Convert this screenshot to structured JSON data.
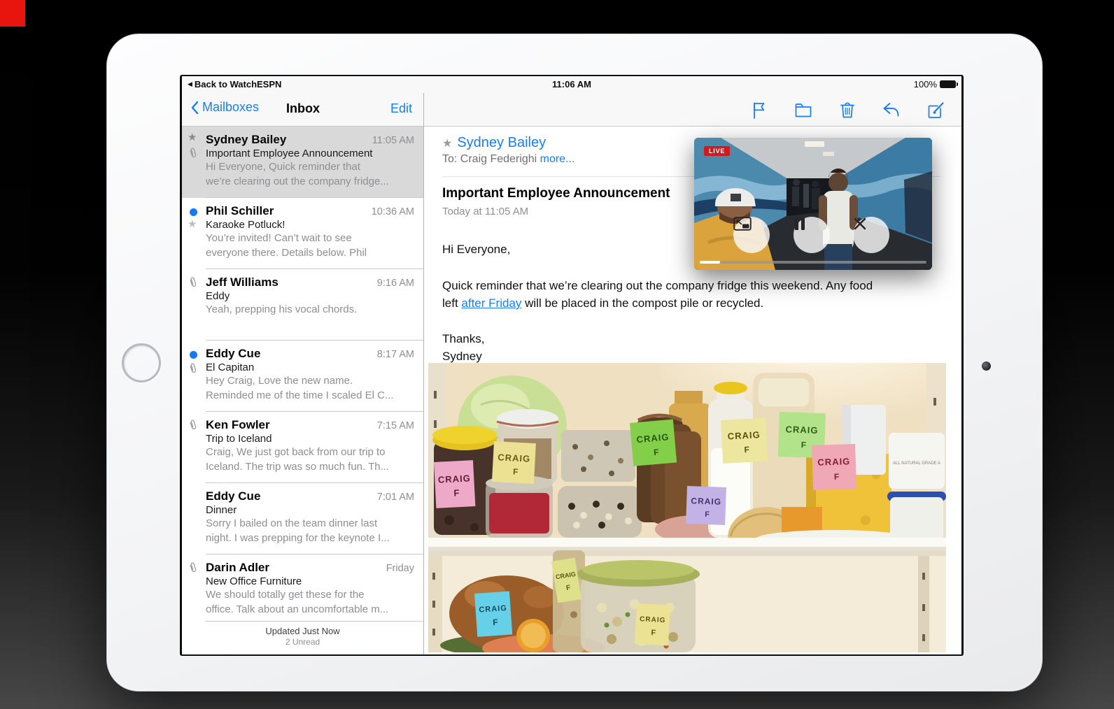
{
  "status_bar": {
    "back": "Back to WatchESPN",
    "time": "11:06 AM",
    "battery": "100%"
  },
  "nav": {
    "back": "Mailboxes",
    "title": "Inbox",
    "edit": "Edit"
  },
  "toolbar": {
    "icons": [
      "flag-icon",
      "folder-icon",
      "trash-icon",
      "reply-icon",
      "compose-icon"
    ],
    "color": "#157ef6"
  },
  "inbox": {
    "rows": [
      {
        "sender": "Sydney Bailey",
        "time": "11:05 AM",
        "subject": "Important Employee Announcement",
        "preview1": "Hi Everyone, Quick reminder that",
        "preview2": "we’re clearing out the company fridge..."
      },
      {
        "sender": "Phil Schiller",
        "time": "10:36 AM",
        "subject": "Karaoke Potluck!",
        "preview1": "You’re invited! Can’t wait to see",
        "preview2": "everyone there. Details below. Phil"
      },
      {
        "sender": "Jeff Williams",
        "time": "9:16 AM",
        "subject": "Eddy",
        "preview1": "Yeah, prepping his vocal chords.",
        "preview2": ""
      },
      {
        "sender": "Eddy Cue",
        "time": "8:17 AM",
        "subject": "El Capitan",
        "preview1": "Hey Craig, Love the new name.",
        "preview2": "Reminded me of the time I scaled El C..."
      },
      {
        "sender": "Ken Fowler",
        "time": "7:15 AM",
        "subject": "Trip to Iceland",
        "preview1": "Craig, We just got back from our trip to",
        "preview2": "Iceland. The trip was so much fun. Th..."
      },
      {
        "sender": "Eddy Cue",
        "time": "7:01 AM",
        "subject": "Dinner",
        "preview1": "Sorry I bailed on the team dinner last",
        "preview2": "night. I was prepping for the keynote I..."
      },
      {
        "sender": "Darin Adler",
        "time": "Friday",
        "subject": "New Office Furniture",
        "preview1": "We should totally get these for the",
        "preview2": "office. Talk about an uncomfortable m..."
      }
    ],
    "updated": "Updated Just Now",
    "unread_count": "2 Unread"
  },
  "message": {
    "from": "Sydney Bailey",
    "to": "To: Craig Federighi",
    "more": "more...",
    "subject": "Important Employee Announcement",
    "date": "Today at 11:05 AM",
    "greeting": "Hi Everyone,",
    "body_line1": "Quick reminder that we’re clearing out the company fridge this weekend. Any food",
    "body_line2_pre": "left ",
    "body_link": "after Friday",
    "body_line2_post": " will be placed in the compost pile or recycled.",
    "closing": "Thanks,",
    "signature": "Sydney"
  },
  "pip": {
    "live": "LIVE"
  },
  "photo": {
    "note": "CRAIG",
    "note_f": "F",
    "yogurt_text": "ALL NATURAL GRADE A"
  },
  "colors": {
    "accent": "#157ef6",
    "live_red": "#d01a1e",
    "selected_row": "#d9d9d9"
  }
}
